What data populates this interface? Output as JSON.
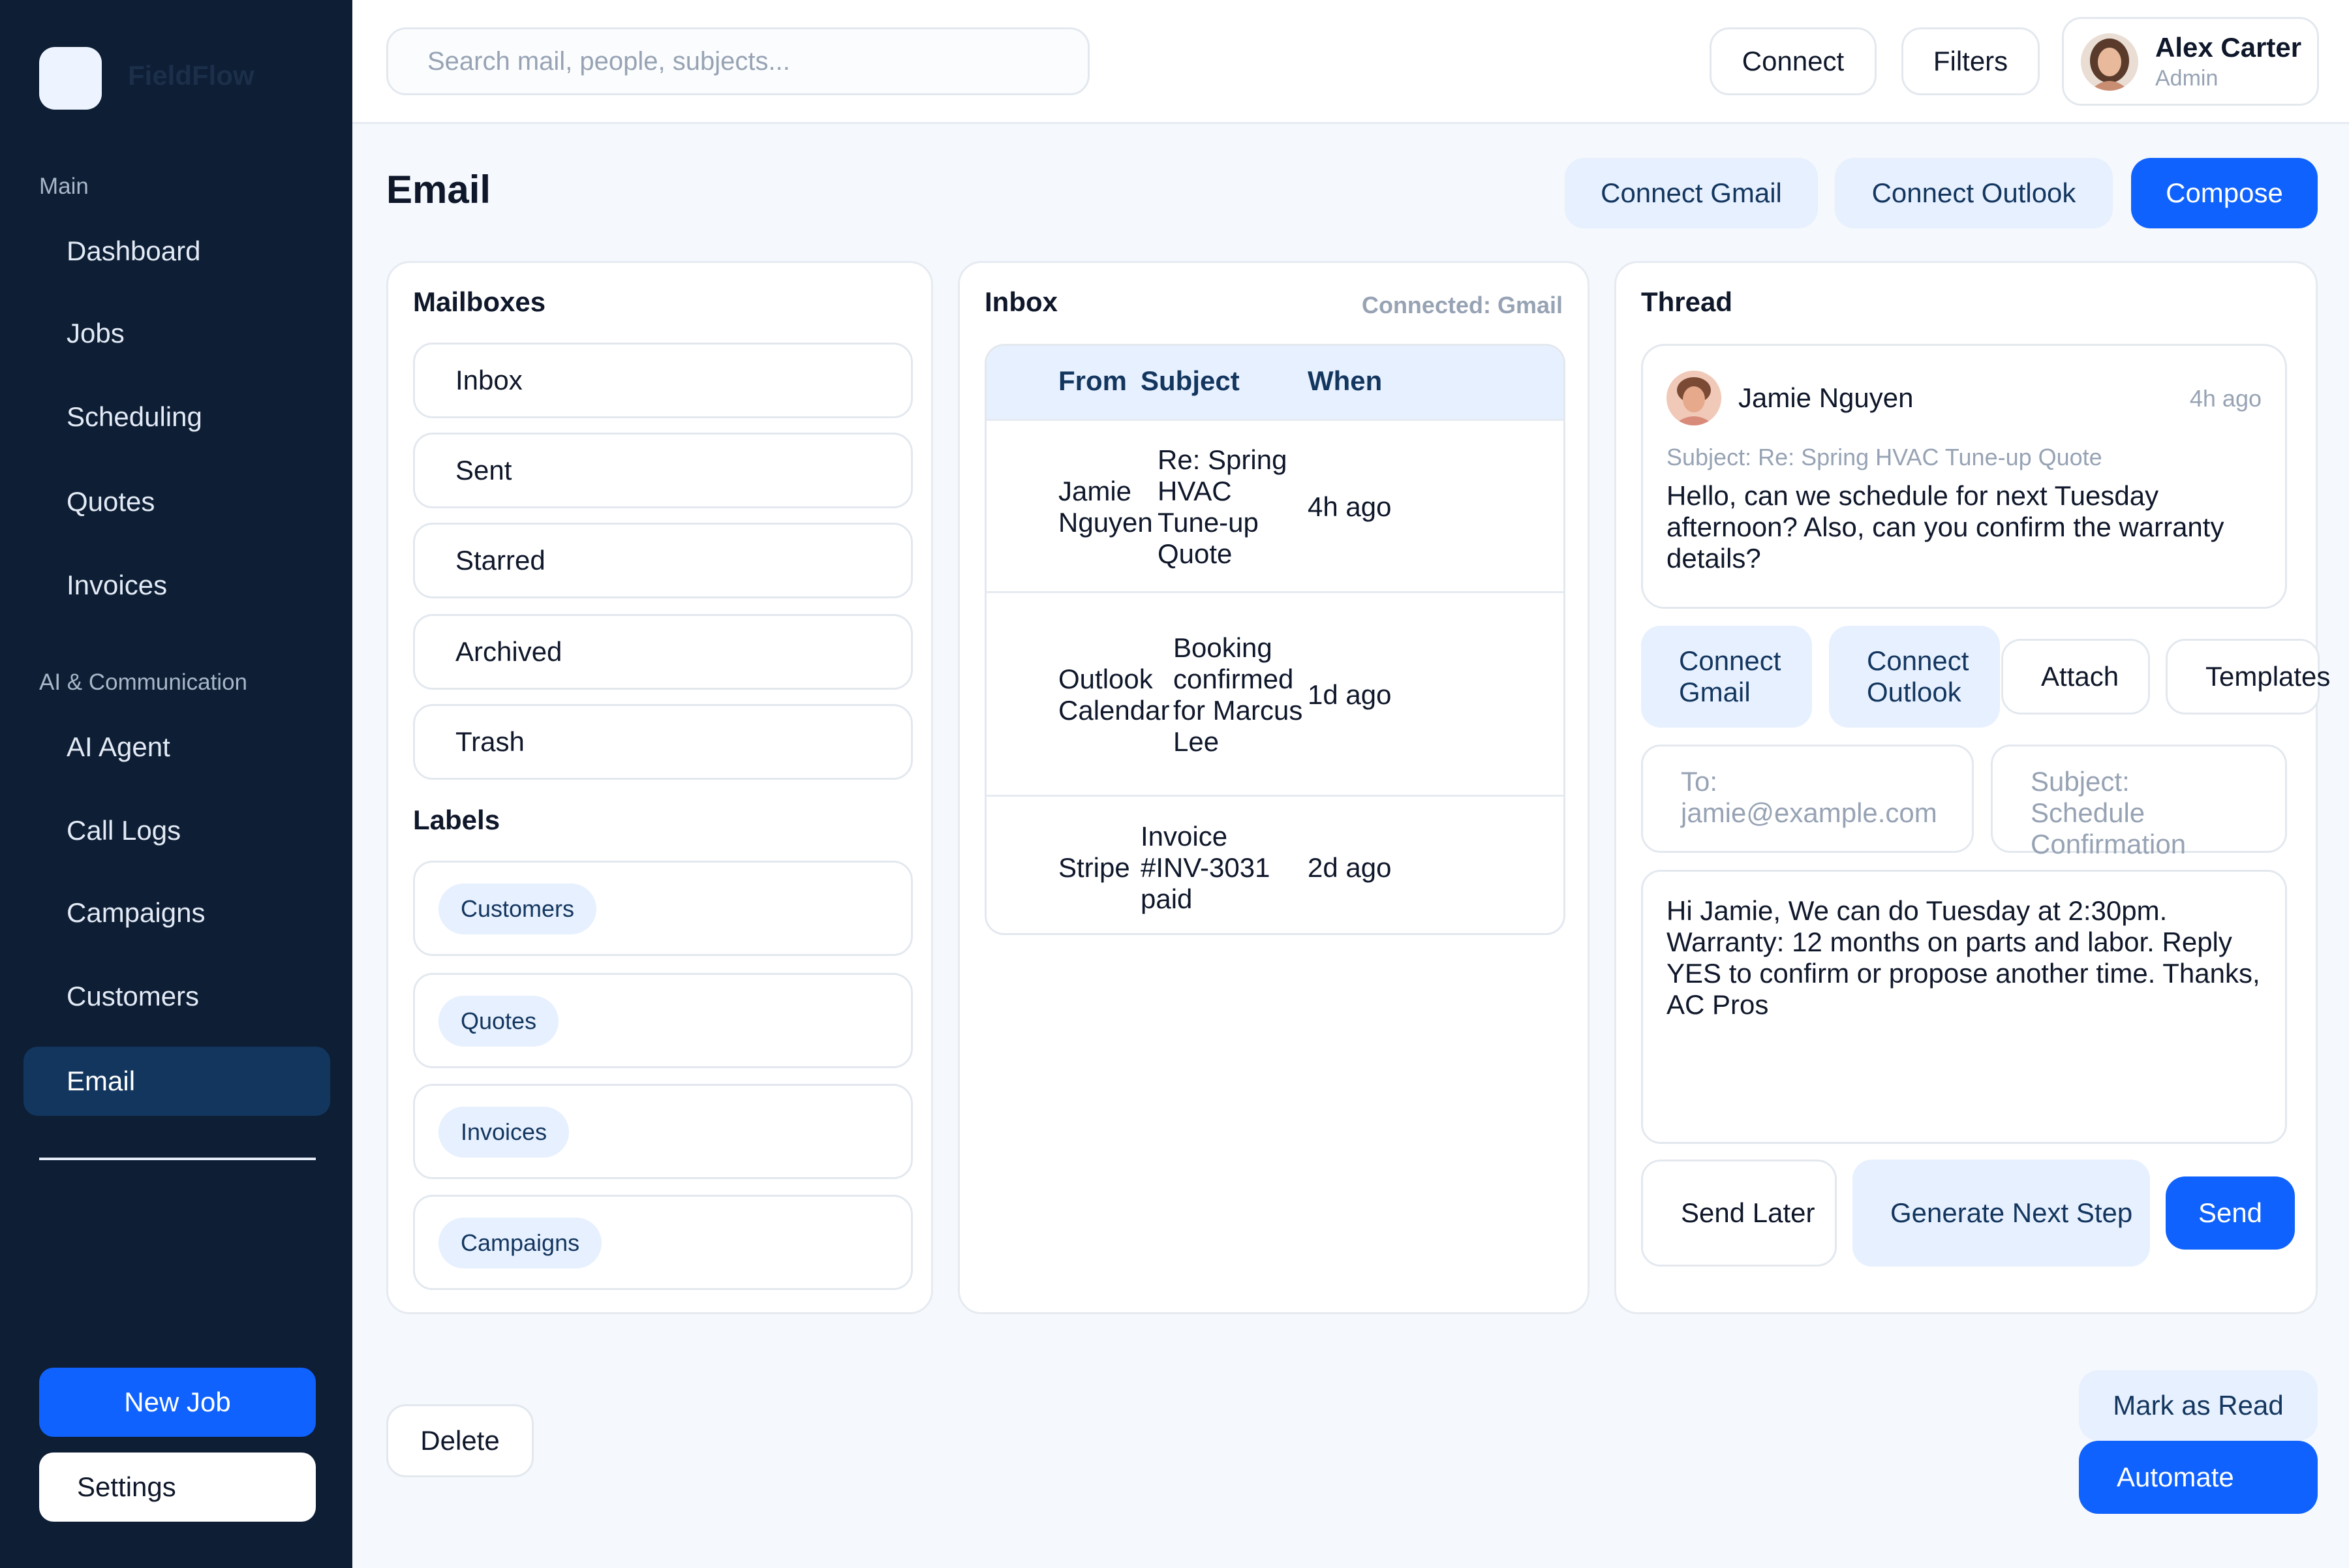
{
  "sidebar": {
    "app_name": "FieldFlow",
    "sections": {
      "main": "Main",
      "ai": "AI & Communication"
    },
    "main_items": [
      "Dashboard",
      "Jobs",
      "Scheduling",
      "Quotes",
      "Invoices"
    ],
    "ai_items": [
      "AI Agent",
      "Call Logs",
      "Campaigns",
      "Customers",
      "Email"
    ],
    "active_item": "Email",
    "new_job": "New Job",
    "settings": "Settings"
  },
  "header": {
    "search_placeholder": "Search mail, people, subjects...",
    "connect": "Connect",
    "filters": "Filters",
    "user_name": "Alex Carter",
    "user_role": "Admin"
  },
  "page": {
    "title": "Email",
    "connect_gmail": "Connect Gmail",
    "connect_outlook": "Connect Outlook",
    "compose": "Compose"
  },
  "mailboxes": {
    "title": "Mailboxes",
    "items": [
      "Inbox",
      "Sent",
      "Starred",
      "Archived",
      "Trash"
    ],
    "labels_title": "Labels",
    "labels": [
      "Customers",
      "Quotes",
      "Invoices",
      "Campaigns"
    ]
  },
  "inbox": {
    "title": "Inbox",
    "connected": "Connected: Gmail",
    "columns": {
      "from": "From",
      "subject": "Subject",
      "when": "When"
    },
    "rows": [
      {
        "from": "Jamie Nguyen",
        "subject": "Re: Spring HVAC Tune-up Quote",
        "when": "4h ago"
      },
      {
        "from": "Outlook Calendar",
        "subject": "Booking confirmed for Marcus Lee",
        "when": "1d ago"
      },
      {
        "from": "Stripe",
        "subject": "Invoice #INV-3031 paid",
        "when": "2d ago"
      }
    ]
  },
  "thread": {
    "title": "Thread",
    "sender": "Jamie Nguyen",
    "time": "4h ago",
    "subject": "Subject: Re: Spring HVAC Tune-up Quote",
    "body": "Hello, can we schedule for next Tuesday afternoon? Also, can you confirm the warranty details?",
    "toolbar": {
      "connect_gmail": "Connect Gmail",
      "connect_outlook": "Connect Outlook",
      "attach": "Attach",
      "templates": "Templates"
    },
    "to_placeholder": "To: jamie@example.com",
    "subject_placeholder": "Subject: Schedule Confirmation",
    "reply_text": "Hi Jamie, We can do Tuesday at 2:30pm. Warranty: 12 months on parts and labor. Reply YES to confirm or propose another time. Thanks, AC Pros",
    "send_later": "Send Later",
    "generate_next_step": "Generate Next Step",
    "send": "Send"
  },
  "footer": {
    "delete": "Delete",
    "mark_as_read": "Mark as Read",
    "automate": "Automate"
  },
  "colors": {
    "sidebar_bg": "#0d1e35",
    "accent": "#0f62fe",
    "soft_accent": "#e7f0fe",
    "active_nav": "#13365f"
  }
}
